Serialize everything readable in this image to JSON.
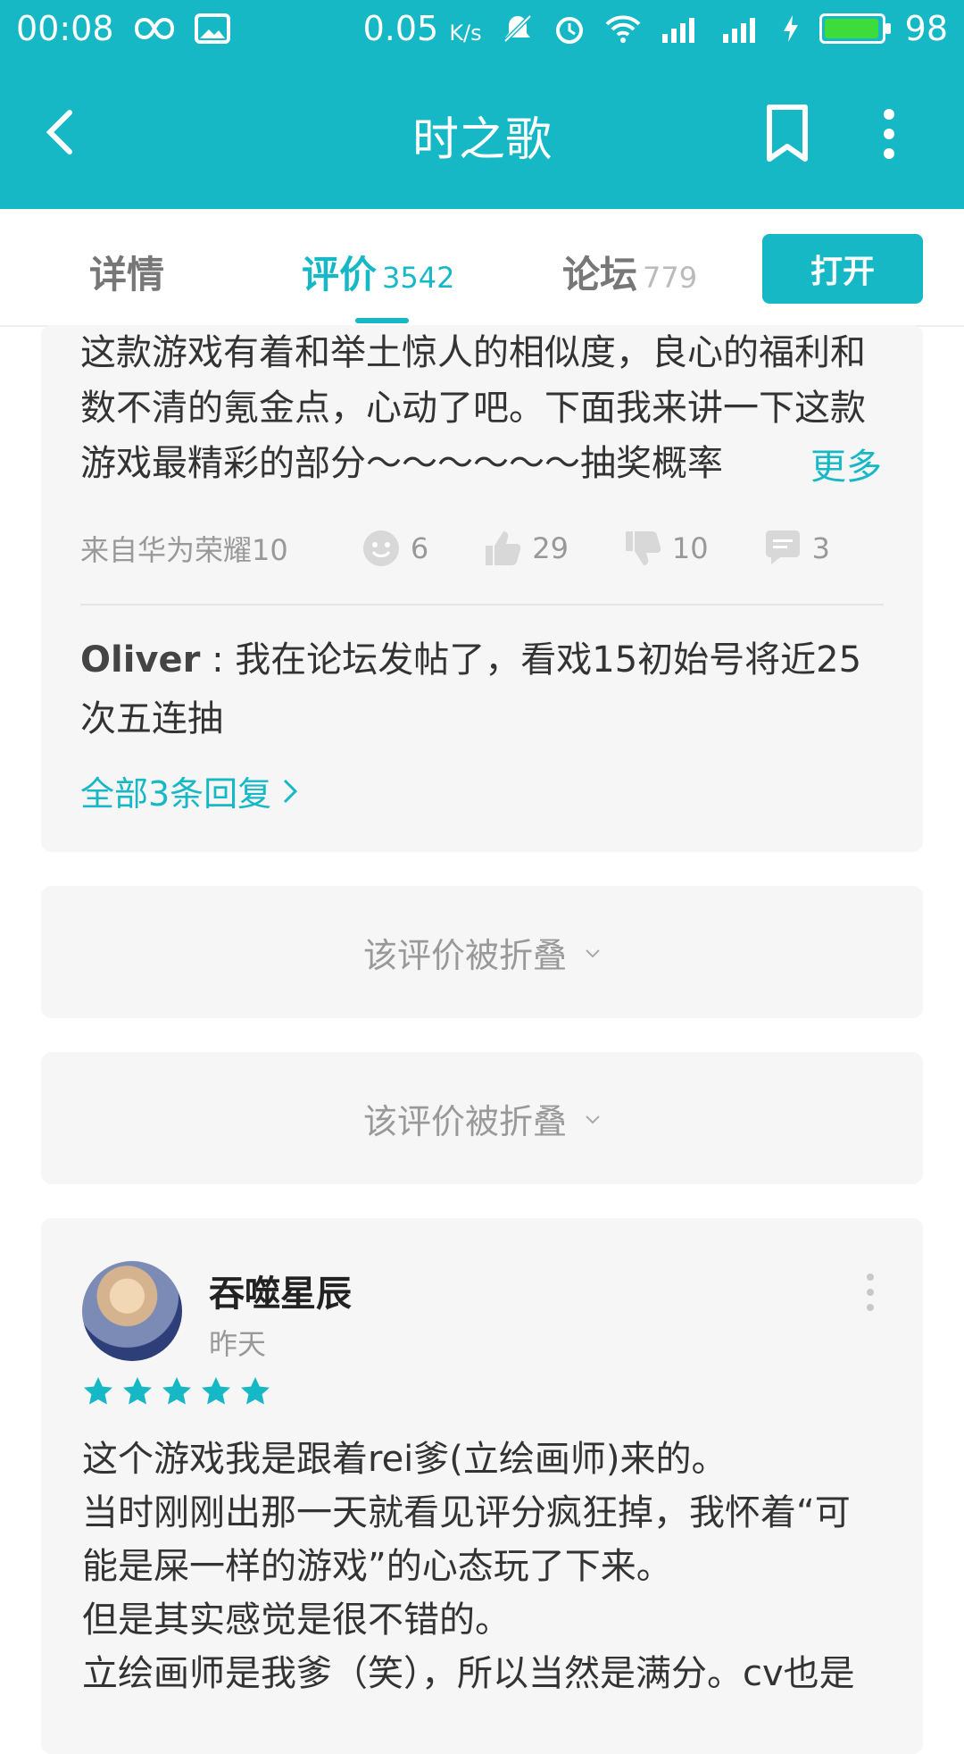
{
  "status_bar": {
    "time": "00:08",
    "network_speed": "0.05",
    "network_speed_unit": "K/s",
    "battery_level": "98",
    "battery_fraction": 0.98,
    "icons": [
      "infinity-icon",
      "image-icon",
      "bell-off-icon",
      "alarm-icon",
      "wifi-icon",
      "signal-3g-icon",
      "signal-3g-icon",
      "charging-icon",
      "battery-icon"
    ]
  },
  "app_bar": {
    "title": "时之歌",
    "colors": {
      "primary": "#16b8c5"
    }
  },
  "tabs": {
    "details_label": "详情",
    "reviews_label": "评价",
    "reviews_count": "3542",
    "forum_label": "论坛",
    "forum_count": "779",
    "open_label": "打开"
  },
  "review_1": {
    "text_fragment": "这款游戏有着和举土惊人的相似度，良心的福利和数不清的氪金点，心动了吧。下面我来讲一下这款游戏最精彩的部分～～～～～～抽奖概率",
    "more_label": "更多",
    "device": "来自华为荣耀10",
    "stats": {
      "smile": "6",
      "like": "29",
      "dislike": "10",
      "comments": "3"
    },
    "reply": {
      "author": "Oliver",
      "text": " : 我在论坛发帖了，看戏15初始号将近25次五连抽"
    },
    "all_replies_label": "全部3条回复"
  },
  "folded_1": {
    "label": "该评价被折叠"
  },
  "folded_2": {
    "label": "该评价被折叠"
  },
  "review_2": {
    "username": "吞噬星辰",
    "time": "昨天",
    "rating": 5,
    "text": "这个游戏我是跟着rei爹(立绘画师)来的。\n当时刚刚出那一天就看见评分疯狂掉，我怀着“可能是屎一样的游戏”的心态玩了下来。\n但是其实感觉是很不错的。\n立绘画师是我爹（笑），所以当然是满分。cv也是"
  }
}
